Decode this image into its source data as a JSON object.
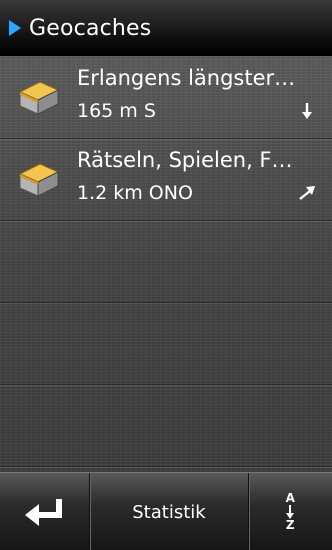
{
  "header": {
    "title": "Geocaches"
  },
  "caches": [
    {
      "title": "Erlangens längster…",
      "distance": "165 m S",
      "direction_icon": "arrow-down-icon"
    },
    {
      "title": "Rätseln, Spielen, F…",
      "distance": "1.2 km ONO",
      "direction_icon": "arrow-northeast-icon"
    }
  ],
  "toolbar": {
    "back_icon": "enter-return-icon",
    "statistics_label": "Statistik",
    "sort_top": "A",
    "sort_bottom": "Z"
  },
  "colors": {
    "accent": "#2aa7ff",
    "icon_top": "#f0c04a",
    "icon_side": "#9a9a9a"
  }
}
